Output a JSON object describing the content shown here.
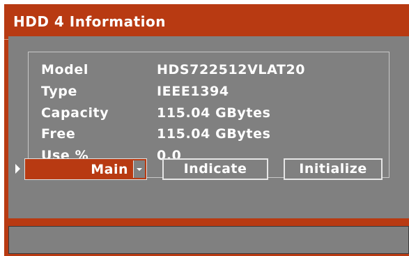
{
  "window": {
    "title": "HDD 4 Information"
  },
  "info": [
    {
      "label": "Model",
      "value": "HDS722512VLAT20"
    },
    {
      "label": "Type",
      "value": "IEEE1394"
    },
    {
      "label": "Capacity",
      "value": "115.04 GBytes"
    },
    {
      "label": "Free",
      "value": "115.04 GBytes"
    },
    {
      "label": "Use %",
      "value": "0.0"
    }
  ],
  "controls": {
    "select_value": "Main",
    "indicate_label": "Indicate",
    "initialize_label": "Initialize"
  },
  "status": {
    "text": ""
  },
  "colors": {
    "accent": "#b83a12",
    "panel": "#808080",
    "text": "#ffffff"
  },
  "icons": {
    "selector_arrow": "triangle-right",
    "dropdown": "chevron-down"
  }
}
